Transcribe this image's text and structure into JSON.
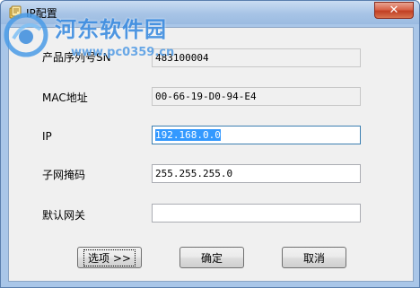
{
  "window": {
    "title": "IP配置",
    "close_label": "✕"
  },
  "watermark": {
    "title": "河东软件园",
    "url": "www.pc0359.cn"
  },
  "form": {
    "serial": {
      "label": "产品序列号SN",
      "value": "483100004"
    },
    "mac": {
      "label": "MAC地址",
      "value": "00-66-19-D0-94-E4"
    },
    "ip": {
      "label": "IP",
      "value": "192.168.0.0"
    },
    "subnet": {
      "label": "子网掩码",
      "value": "255.255.255.0"
    },
    "gateway": {
      "label": "默认网关",
      "value": ""
    }
  },
  "buttons": {
    "options_label": "选项 >>",
    "ok_label": "确定",
    "cancel_label": "取消"
  },
  "colors": {
    "titlebar": "#a9c6e8",
    "selection": "#3399ff",
    "close": "#c13f24"
  }
}
